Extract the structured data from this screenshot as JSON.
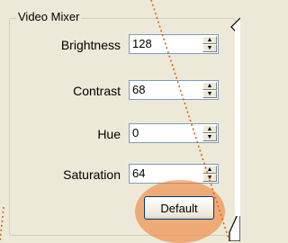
{
  "group": {
    "title": "Video Mixer"
  },
  "fields": [
    {
      "label": "Brightness",
      "value": "128"
    },
    {
      "label": "Contrast",
      "value": "68"
    },
    {
      "label": "Hue",
      "value": "0"
    },
    {
      "label": "Saturation",
      "value": "64"
    }
  ],
  "buttons": {
    "default_label": "Default"
  },
  "colors": {
    "highlight": "#f07828",
    "callout_dots": "#e06010"
  }
}
